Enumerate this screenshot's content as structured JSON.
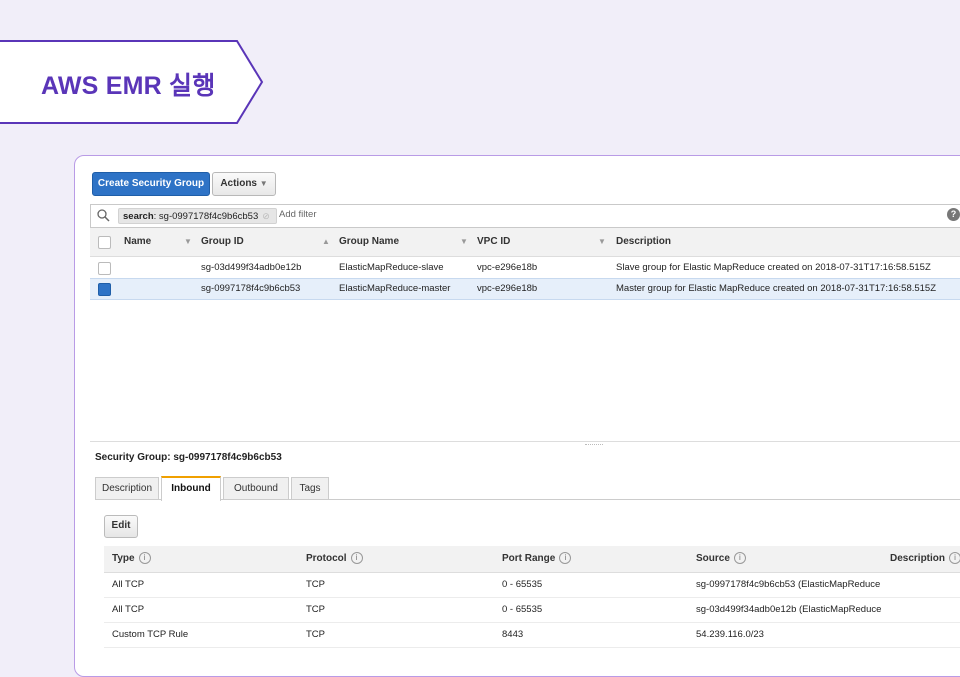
{
  "banner": {
    "title": "AWS EMR 실행"
  },
  "toolbar": {
    "create_label": "Create Security Group",
    "actions_label": "Actions"
  },
  "search": {
    "token_key": "search",
    "token_value": ": sg-0997178f4c9b6cb53",
    "add_filter": "Add filter"
  },
  "table": {
    "columns": [
      "Name",
      "Group ID",
      "Group Name",
      "VPC ID",
      "Description"
    ],
    "rows": [
      {
        "name": "",
        "group_id": "sg-03d499f34adb0e12b",
        "group_name": "ElasticMapReduce-slave",
        "vpc_id": "vpc-e296e18b",
        "description": "Slave group for Elastic MapReduce created on 2018-07-31T17:16:58.515Z",
        "selected": false
      },
      {
        "name": "",
        "group_id": "sg-0997178f4c9b6cb53",
        "group_name": "ElasticMapReduce-master",
        "vpc_id": "vpc-e296e18b",
        "description": "Master group for Elastic MapReduce created on 2018-07-31T17:16:58.515Z",
        "selected": true
      }
    ]
  },
  "details": {
    "title": "Security Group: sg-0997178f4c9b6cb53",
    "tabs": [
      "Description",
      "Inbound",
      "Outbound",
      "Tags"
    ],
    "active_tab": "Inbound",
    "edit_label": "Edit",
    "rules_columns": [
      "Type",
      "Protocol",
      "Port Range",
      "Source",
      "Description"
    ],
    "rules": [
      {
        "type": "All TCP",
        "protocol": "TCP",
        "port_range": "0 - 65535",
        "source": "sg-0997178f4c9b6cb53 (ElasticMapReduce"
      },
      {
        "type": "All TCP",
        "protocol": "TCP",
        "port_range": "0 - 65535",
        "source": "sg-03d499f34adb0e12b (ElasticMapReduce"
      },
      {
        "type": "Custom TCP Rule",
        "protocol": "TCP",
        "port_range": "8443",
        "source": "54.239.116.0/23"
      }
    ]
  },
  "colors": {
    "accent": "#5a35b8",
    "primary_button": "#2e73c6",
    "frame_border": "#b99be6"
  }
}
